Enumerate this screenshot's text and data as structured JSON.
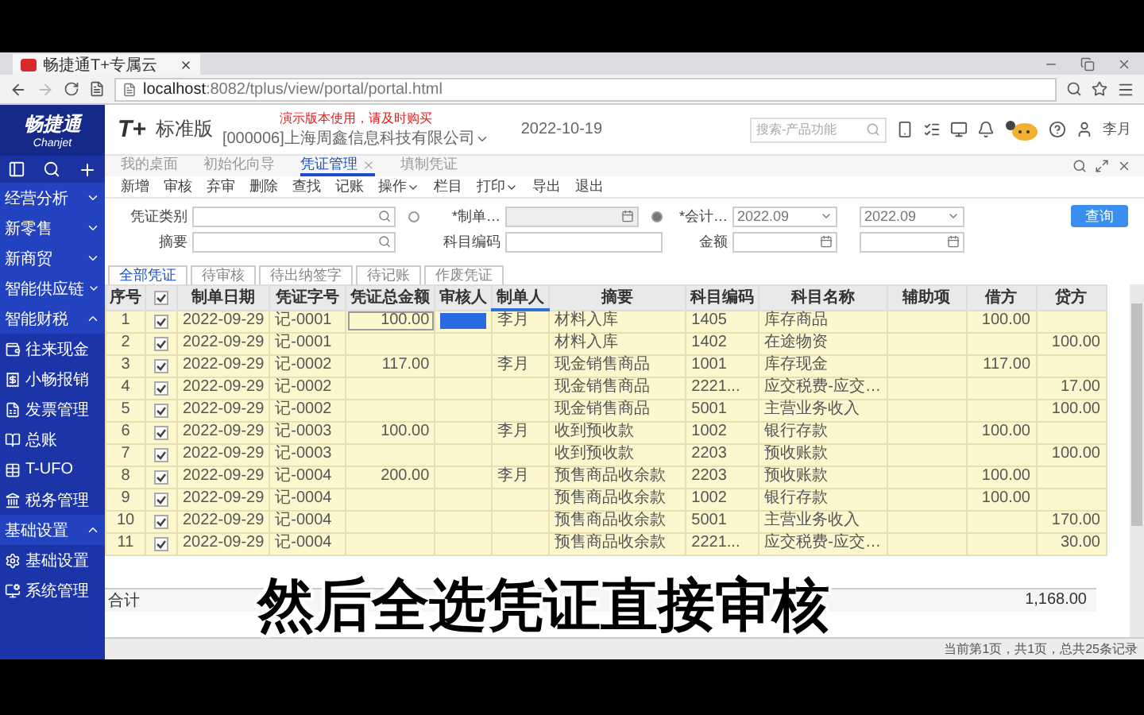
{
  "browser": {
    "tab_title": "畅捷通T+专属云",
    "url_host": "localhost",
    "url_rest": ":8082/tplus/view/portal/portal.html"
  },
  "sidebar": {
    "brand": "畅捷通",
    "brand_sub": "Chanjet",
    "groups": [
      {
        "label": "经营分析",
        "expanded": false
      },
      {
        "label": "新零售",
        "expanded": false
      },
      {
        "label": "新商贸",
        "expanded": false
      },
      {
        "label": "智能供应链",
        "expanded": false
      },
      {
        "label": "智能财税",
        "expanded": true,
        "children": [
          {
            "label": "往来现金"
          },
          {
            "label": "小畅报销"
          },
          {
            "label": "发票管理"
          },
          {
            "label": "总账"
          },
          {
            "label": "T-UFO"
          },
          {
            "label": "税务管理"
          }
        ]
      },
      {
        "label": "基础设置",
        "expanded": true,
        "children": [
          {
            "label": "基础设置"
          },
          {
            "label": "系统管理"
          }
        ]
      }
    ]
  },
  "header": {
    "logo": "T+",
    "product": "标准版",
    "company": "[000006]上海周鑫信息科技有限公司",
    "date": "2022-10-19",
    "notice": "演示版本使用，请及时购买",
    "search": {
      "placeholder": "搜索-产品功能"
    },
    "user": "李月"
  },
  "page_tabs": [
    {
      "label": "我的桌面",
      "selected": false
    },
    {
      "label": "初始化向导",
      "selected": false
    },
    {
      "label": "凭证管理",
      "selected": true
    },
    {
      "label": "填制凭证",
      "selected": false
    }
  ],
  "toolbar": [
    {
      "label": "新增",
      "dropdown": false
    },
    {
      "label": "审核",
      "dropdown": false
    },
    {
      "label": "弃审",
      "dropdown": false
    },
    {
      "label": "删除",
      "dropdown": false
    },
    {
      "label": "查找",
      "dropdown": false
    },
    {
      "label": "记账",
      "dropdown": false
    },
    {
      "label": "操作",
      "dropdown": true
    },
    {
      "label": "栏目",
      "dropdown": false
    },
    {
      "label": "打印",
      "dropdown": true
    },
    {
      "label": "导出",
      "dropdown": false
    },
    {
      "label": "退出",
      "dropdown": false
    }
  ],
  "filters": {
    "category": {
      "label": "凭证类别"
    },
    "summary": {
      "label": "摘要"
    },
    "date_mode": [
      {
        "label": "*制单…",
        "selected": false
      },
      {
        "label": "*会计…",
        "selected": true
      }
    ],
    "period_from": "2022.09",
    "period_to": "2022.09",
    "account_code": {
      "label": "科目编码"
    },
    "amount": {
      "label": "金额"
    },
    "query_button": "查询"
  },
  "voucher_tabs": [
    {
      "label": "全部凭证",
      "selected": true
    },
    {
      "label": "待审核",
      "selected": false
    },
    {
      "label": "待出纳签字",
      "selected": false
    },
    {
      "label": "待记账",
      "selected": false
    },
    {
      "label": "作废凭证",
      "selected": false
    }
  ],
  "table": {
    "select_all": {
      "checked": true
    },
    "columns": [
      "序号",
      "制单日期",
      "凭证字号",
      "凭证总金额",
      "审核人",
      "制单人",
      "摘要",
      "科目编码",
      "科目名称",
      "辅助项",
      "借方",
      "贷方"
    ],
    "rows": [
      {
        "no": "1",
        "checked": true,
        "date": "2022-09-29",
        "voucher_no": "记-0001",
        "total": "100.00",
        "reviewer_active": true,
        "maker": "李月",
        "summary": "材料入库",
        "account_code": "1405",
        "account_name": "库存商品",
        "debit": "100.00",
        "credit": ""
      },
      {
        "no": "2",
        "checked": true,
        "date": "2022-09-29",
        "voucher_no": "记-0001",
        "total": "",
        "reviewer_active": false,
        "maker": "",
        "summary": "材料入库",
        "account_code": "1402",
        "account_name": "在途物资",
        "debit": "",
        "credit": "100.00"
      },
      {
        "no": "3",
        "checked": true,
        "date": "2022-09-29",
        "voucher_no": "记-0002",
        "total": "117.00",
        "reviewer_active": false,
        "maker": "李月",
        "summary": "现金销售商品",
        "account_code": "1001",
        "account_name": "库存现金",
        "debit": "117.00",
        "credit": ""
      },
      {
        "no": "4",
        "checked": true,
        "date": "2022-09-29",
        "voucher_no": "记-0002",
        "total": "",
        "reviewer_active": false,
        "maker": "",
        "summary": "现金销售商品",
        "account_code": "2221...",
        "account_name": "应交税费-应交…",
        "debit": "",
        "credit": "17.00"
      },
      {
        "no": "5",
        "checked": true,
        "date": "2022-09-29",
        "voucher_no": "记-0002",
        "total": "",
        "reviewer_active": false,
        "maker": "",
        "summary": "现金销售商品",
        "account_code": "5001",
        "account_name": "主营业务收入",
        "debit": "",
        "credit": "100.00"
      },
      {
        "no": "6",
        "checked": true,
        "date": "2022-09-29",
        "voucher_no": "记-0003",
        "total": "100.00",
        "reviewer_active": false,
        "maker": "李月",
        "summary": "收到预收款",
        "account_code": "1002",
        "account_name": "银行存款",
        "debit": "100.00",
        "credit": ""
      },
      {
        "no": "7",
        "checked": true,
        "date": "2022-09-29",
        "voucher_no": "记-0003",
        "total": "",
        "reviewer_active": false,
        "maker": "",
        "summary": "收到预收款",
        "account_code": "2203",
        "account_name": "预收账款",
        "debit": "",
        "credit": "100.00"
      },
      {
        "no": "8",
        "checked": true,
        "date": "2022-09-29",
        "voucher_no": "记-0004",
        "total": "200.00",
        "reviewer_active": false,
        "maker": "李月",
        "summary": "预售商品收余款",
        "account_code": "2203",
        "account_name": "预收账款",
        "debit": "100.00",
        "credit": ""
      },
      {
        "no": "9",
        "checked": true,
        "date": "2022-09-29",
        "voucher_no": "记-0004",
        "total": "",
        "reviewer_active": false,
        "maker": "",
        "summary": "预售商品收余款",
        "account_code": "1002",
        "account_name": "银行存款",
        "debit": "100.00",
        "credit": ""
      },
      {
        "no": "10",
        "checked": true,
        "date": "2022-09-29",
        "voucher_no": "记-0004",
        "total": "",
        "reviewer_active": false,
        "maker": "",
        "summary": "预售商品收余款",
        "account_code": "5001",
        "account_name": "主营业务收入",
        "debit": "",
        "credit": "170.00"
      },
      {
        "no": "11",
        "checked": true,
        "date": "2022-09-29",
        "voucher_no": "记-0004",
        "total": "",
        "reviewer_active": false,
        "maker": "",
        "summary": "预售商品收余款",
        "account_code": "2221...",
        "account_name": "应交税费-应交…",
        "debit": "",
        "credit": "30.00"
      }
    ],
    "totals": {
      "label": "合计",
      "credit": "1,168.00"
    }
  },
  "pager": "当前第1页，共1页，总共25条记录",
  "subtitle": "然后全选凭证直接审核"
}
